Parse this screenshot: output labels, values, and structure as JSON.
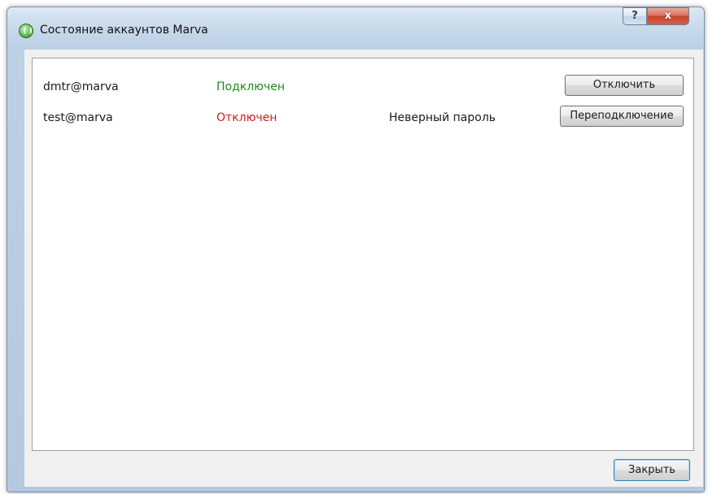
{
  "window": {
    "title": "Состояние аккаунтов Marva",
    "app_icon": "marva-app-icon",
    "help_button": "?",
    "close_button": "x"
  },
  "accounts": [
    {
      "account": "dmtr@marva",
      "status": "Подключен",
      "status_color": "#1f8a1f",
      "error": "",
      "action_label": "Отключить"
    },
    {
      "account": "test@marva",
      "status": "Отключен",
      "status_color": "#d31a1a",
      "error": "Неверный пароль",
      "action_label": "Переподключение"
    }
  ],
  "footer": {
    "close_label": "Закрыть"
  }
}
